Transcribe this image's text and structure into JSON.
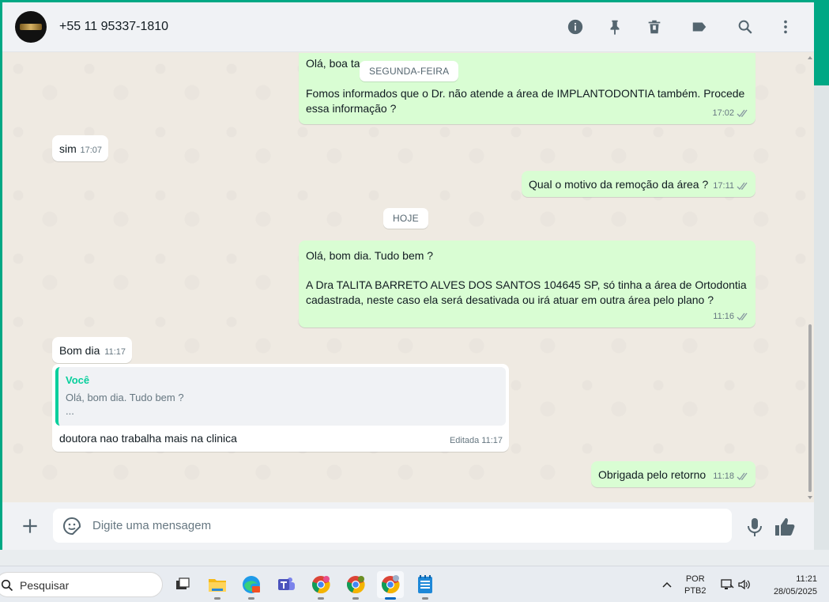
{
  "header": {
    "contact": "+55 11 95337-1810",
    "icons": [
      "info-icon",
      "pin-icon",
      "delete-icon",
      "label-icon",
      "search-icon",
      "menu-icon"
    ]
  },
  "chat": {
    "day_labels": {
      "monday": "SEGUNDA-FEIRA",
      "today": "HOJE"
    },
    "messages": {
      "m1": {
        "line1": "Olá, boa ta",
        "line2": "Fomos informados que o Dr. não atende a área de IMPLANTODONTIA também. Procede",
        "line3": "essa informação ?",
        "time": "17:02"
      },
      "m2": {
        "text": "sim",
        "time": "17:07"
      },
      "m3": {
        "text": "Qual o motivo da remoção da área ?",
        "time": "17:11"
      },
      "m4": {
        "line1": "Olá, bom dia. Tudo bem ?",
        "line2": "A Dra TALITA BARRETO ALVES DOS SANTOS 104645 SP, só tinha a área de Ortodontia",
        "line3": "cadastrada, neste caso ela será desativada ou irá atuar em outra área pelo plano ?",
        "time": "11:16"
      },
      "m5": {
        "text": "Bom dia",
        "time": "11:17"
      },
      "m6": {
        "quote_author": "Você",
        "quote_line1": "Olá, bom dia. Tudo bem ?",
        "quote_line2": "...",
        "text": "doutora nao trabalha mais na clinica",
        "edited": "Editada",
        "time": "11:17"
      },
      "m7": {
        "text": "Obrigada pelo retorno",
        "time": "11:18"
      }
    }
  },
  "composer": {
    "placeholder": "Digite uma mensagem"
  },
  "taskbar": {
    "search_label": "Pesquisar",
    "lang_line1": "POR",
    "lang_line2": "PTB2",
    "time": "11:21",
    "date": "28/05/2025"
  },
  "colors": {
    "accent": "#00a884",
    "outgoing": "#d9fdd3",
    "incoming": "#ffffff",
    "background": "#efeae2"
  }
}
